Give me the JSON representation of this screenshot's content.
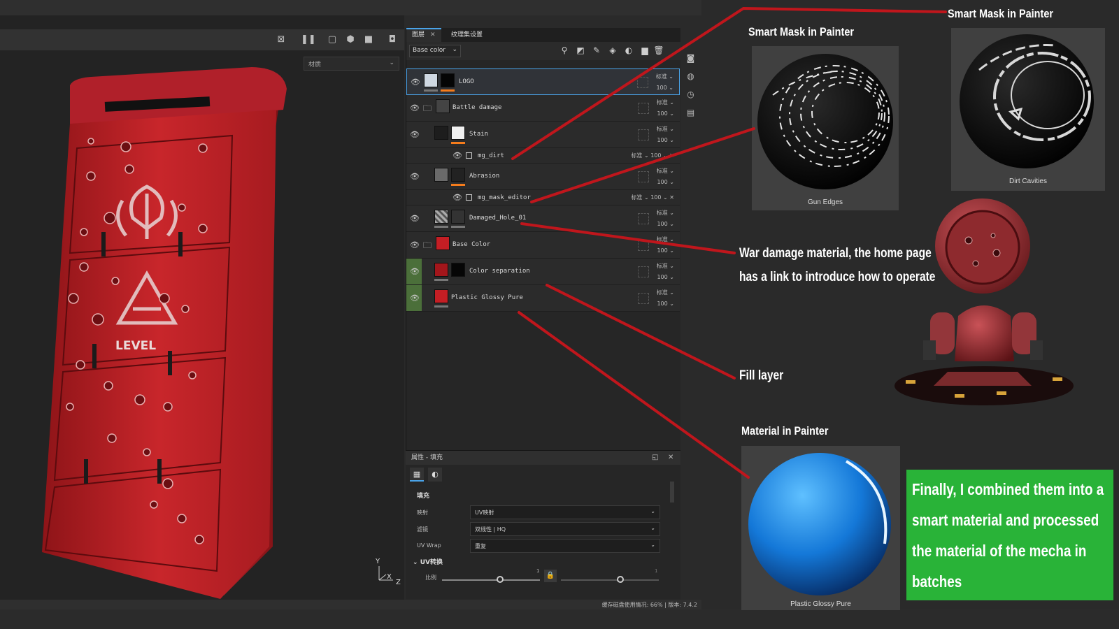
{
  "viewport": {
    "material_select": "材质",
    "locker_label": "LEVEL",
    "axis_y": "Y",
    "axis_z": "Z",
    "axis_x": "X"
  },
  "layers_panel": {
    "tab_layers": "图层",
    "tab_texture_set": "纹理集设置",
    "channel": "Base color",
    "layers": [
      {
        "name": "LOGO",
        "blend": "标准",
        "opacity": "100"
      },
      {
        "name": "Battle damage",
        "blend": "标准",
        "opacity": "100"
      },
      {
        "name": "Stain",
        "blend": "标准",
        "opacity": "100"
      },
      {
        "name": "Abrasion",
        "blend": "标准",
        "opacity": "100"
      },
      {
        "name": "Damaged_Hole_01",
        "blend": "标准",
        "opacity": "100"
      },
      {
        "name": "Base Color",
        "blend": "标准",
        "opacity": "100"
      },
      {
        "name": "Color separation",
        "blend": "标准",
        "opacity": "100"
      },
      {
        "name": "Plastic Glossy Pure",
        "blend": "标准",
        "opacity": "100"
      }
    ],
    "sublayers": [
      {
        "name": "mg_dirt",
        "blend": "标准",
        "opacity": "100"
      },
      {
        "name": "mg_mask_editor",
        "blend": "标准",
        "opacity": "100"
      }
    ]
  },
  "properties": {
    "title": "属性 - 填充",
    "section_fill": "填充",
    "rows": [
      {
        "label": "映射",
        "value": "UV映射"
      },
      {
        "label": "滤镜",
        "value": "双线性 | HQ"
      },
      {
        "label": "UV Wrap",
        "value": "重复"
      }
    ],
    "uv_transform": "UV转换",
    "scale_label": "比例",
    "scale_value": "1",
    "scale_value_right": "1"
  },
  "statusbar": {
    "text": "缓存磁盘使用情况:  66%  |  版本:  7.4.2"
  },
  "annotations": {
    "smart_mask_1": "Smart Mask in Painter",
    "smart_mask_2": "Smart Mask in Painter",
    "gun_edges": "Gun Edges",
    "dirt_cavities": "Dirt Cavities",
    "war_damage_line1": "War damage material, the home page",
    "war_damage_line2": "has a link to introduce how to operate",
    "fill_layer": "Fill layer",
    "material_in_painter": "Material in Painter",
    "plastic_glossy_pure": "Plastic Glossy Pure",
    "final_line1": "Finally, I combined them into a",
    "final_line2": "smart material and processed",
    "final_line3": "the material of the mecha in",
    "final_line4": "batches"
  },
  "colors": {
    "accent": "#4aa3e8",
    "annotation_line": "#c0161c",
    "green_box": "#29b338",
    "layer_red": "#c41e24"
  }
}
